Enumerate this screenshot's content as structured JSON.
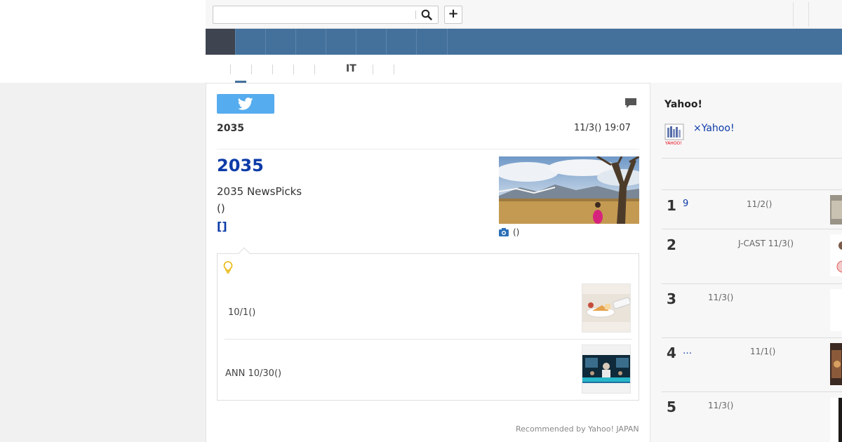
{
  "header": {
    "search": {
      "value": "",
      "placeholder": ""
    },
    "plus_label": "+"
  },
  "subnav": {
    "it_label": "IT"
  },
  "article": {
    "source": "2035",
    "timestamp": "11/3() 19:07",
    "headline": "2035",
    "lead_line1": "2035  NewsPicks",
    "lead_line2": "()",
    "read_more": "[]",
    "photo_caption": "()",
    "related": [
      {
        "text": "10/1()"
      },
      {
        "text": "ANN 10/30()"
      }
    ],
    "recommended": "Recommended by Yahoo! JAPAN"
  },
  "sidebar": {
    "title": "Yahoo!",
    "promo_link": "×Yahoo!",
    "ranking": [
      {
        "num": "1",
        "link": "9",
        "meta": "11/2()"
      },
      {
        "num": "2",
        "link": "",
        "meta": "J-CAST   11/3()"
      },
      {
        "num": "3",
        "link": "",
        "meta": "11/3()"
      },
      {
        "num": "4",
        "link": "…",
        "meta": "11/1()"
      },
      {
        "num": "5",
        "link": "",
        "meta": "11/3()"
      }
    ]
  },
  "colors": {
    "nav_bg": "#44719c",
    "nav_active": "#3f4550",
    "link_blue": "#0d3ba8",
    "twitter": "#55acee"
  }
}
